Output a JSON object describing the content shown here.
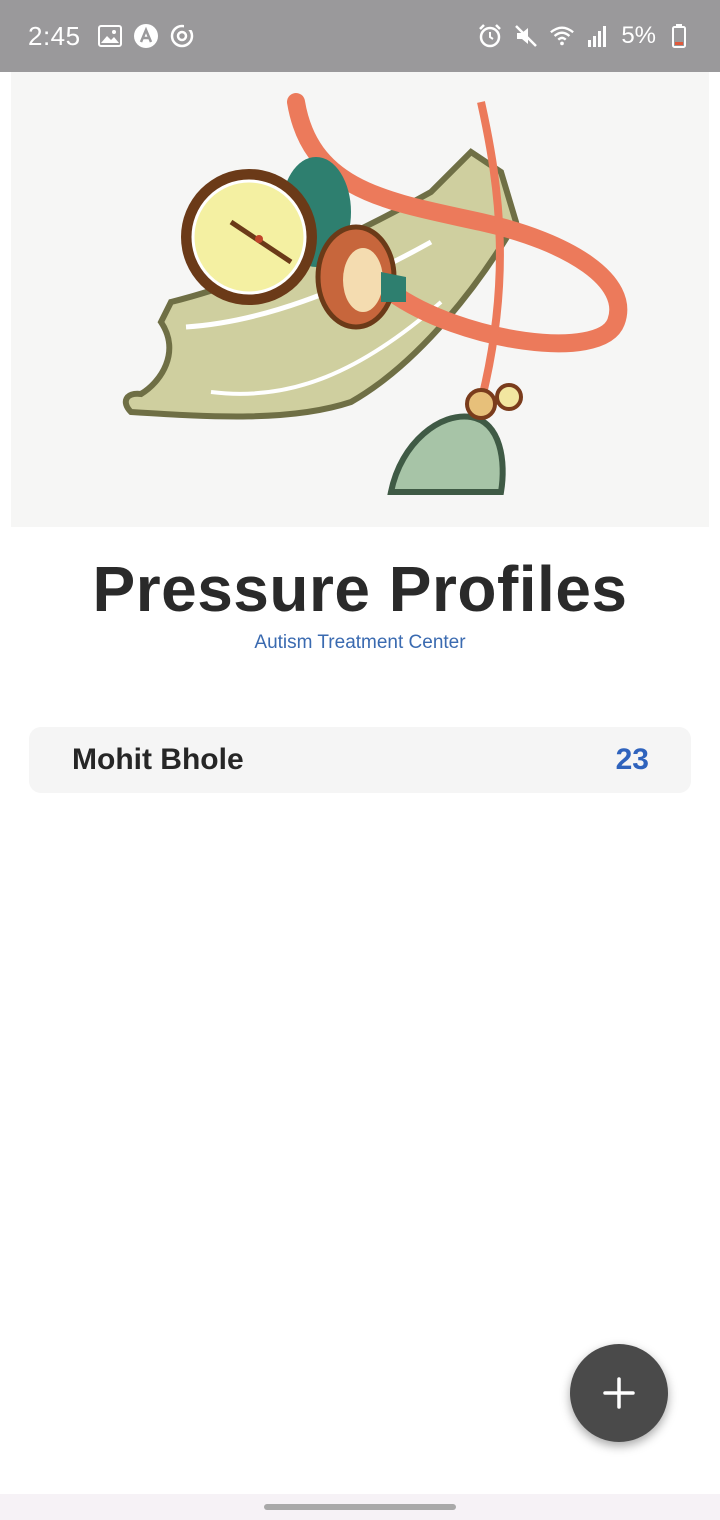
{
  "status_bar": {
    "time": "2:45",
    "battery_percent": "5%",
    "left_icons": [
      "image-icon",
      "a-circle-icon",
      "sync-icon"
    ],
    "right_icons": [
      "alarm-icon",
      "mute-icon",
      "wifi-icon",
      "signal-icon",
      "battery-icon"
    ]
  },
  "hero": {
    "image": "blood-pressure-cuff-illustration"
  },
  "header": {
    "title": "Pressure Profiles",
    "subtitle": "Autism Treatment Center"
  },
  "profiles": [
    {
      "name": "Mohit Bhole",
      "count": "23"
    }
  ],
  "fab": {
    "icon": "plus-icon"
  },
  "colors": {
    "status_bar": "#9a999b",
    "accent_blue": "#2f63bd",
    "subtitle_blue": "#3a6ab0",
    "fab": "#4a4a4a",
    "row_bg": "#f5f5f5"
  }
}
